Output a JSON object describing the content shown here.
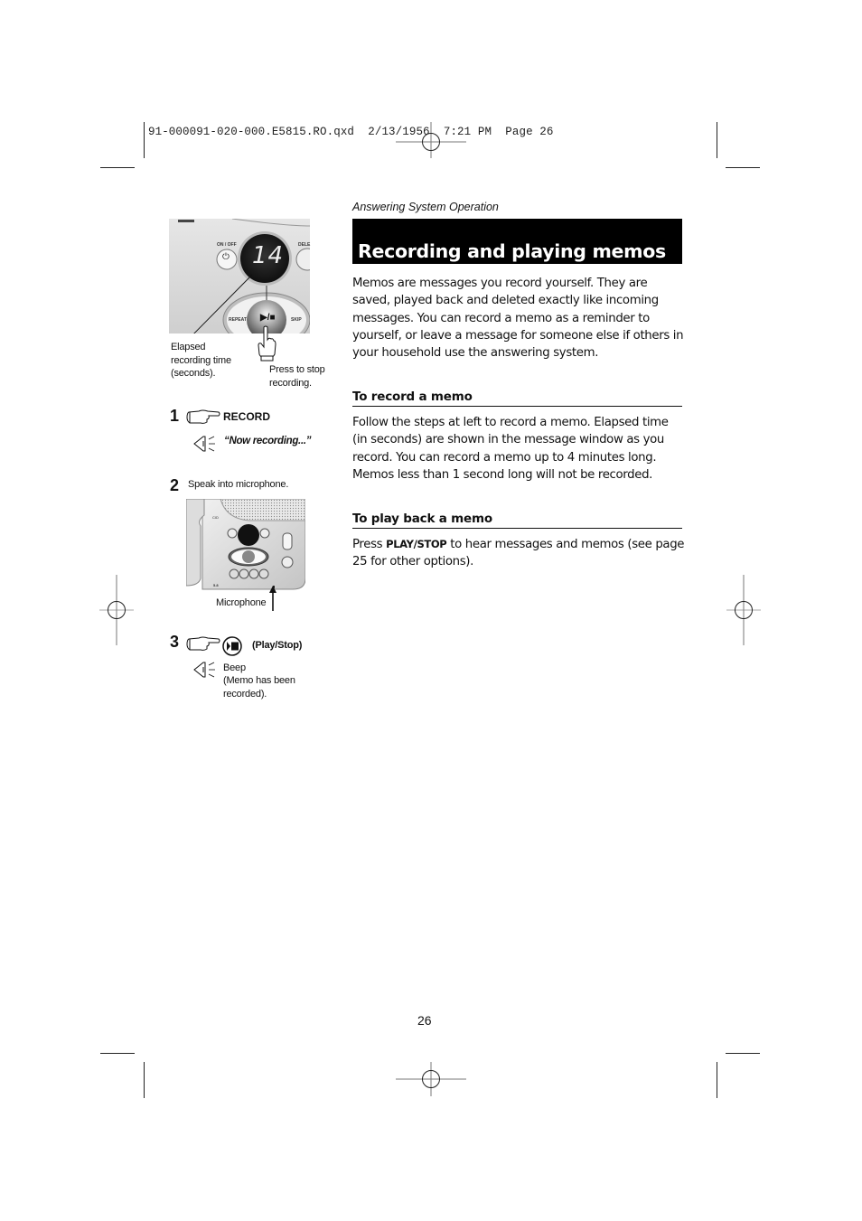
{
  "slug": {
    "text": "91-000091-020-000.E5815.RO.qxd  2/13/1956  7:21 PM  Page 26"
  },
  "header": {
    "section_label": "Answering System Operation",
    "title": "Recording and playing memos"
  },
  "intro": {
    "text": "Memos are messages you record yourself. They are saved, played back and deleted exactly like incoming messages. You can record a memo as a reminder to yourself, or leave a message for someone else if others in your household use the answering system."
  },
  "record_section": {
    "heading": "To record a memo",
    "text": "Follow the steps at left to record a memo. Elapsed time (in seconds) are shown in the message window as you record. You can record a memo up to 4 minutes long. Memos less than 1 second long will not be recorded."
  },
  "playback_section": {
    "heading": "To play back a memo",
    "text_before": "Press ",
    "keyword": "PLAY/STOP",
    "text_after": " to hear messages and memos (see page 25 for other options)."
  },
  "figure_top": {
    "display_value": "14",
    "on_off_label": "ON / OFF",
    "delete_label": "DELE",
    "repeat_label": "REPEAT",
    "skip_label": "SKIP",
    "callout_elapsed": "Elapsed recording time (seconds).",
    "callout_press": "Press to stop recording."
  },
  "steps": [
    {
      "number": "1",
      "action": "RECORD",
      "audio": "“Now recording...”"
    },
    {
      "number": "2",
      "action": "Speak into microphone.",
      "figure_label": "Microphone"
    },
    {
      "number": "3",
      "action": "(Play/Stop)",
      "audio_lines": [
        "Beep",
        "(Memo has been",
        "recorded)."
      ]
    }
  ],
  "footer": {
    "page_number": "26"
  },
  "colors": {
    "title_bar_bg": "#000000",
    "title_text": "#ffffff",
    "device_panel": "#dcdcdc",
    "display_bg": "#1a1a1a"
  }
}
